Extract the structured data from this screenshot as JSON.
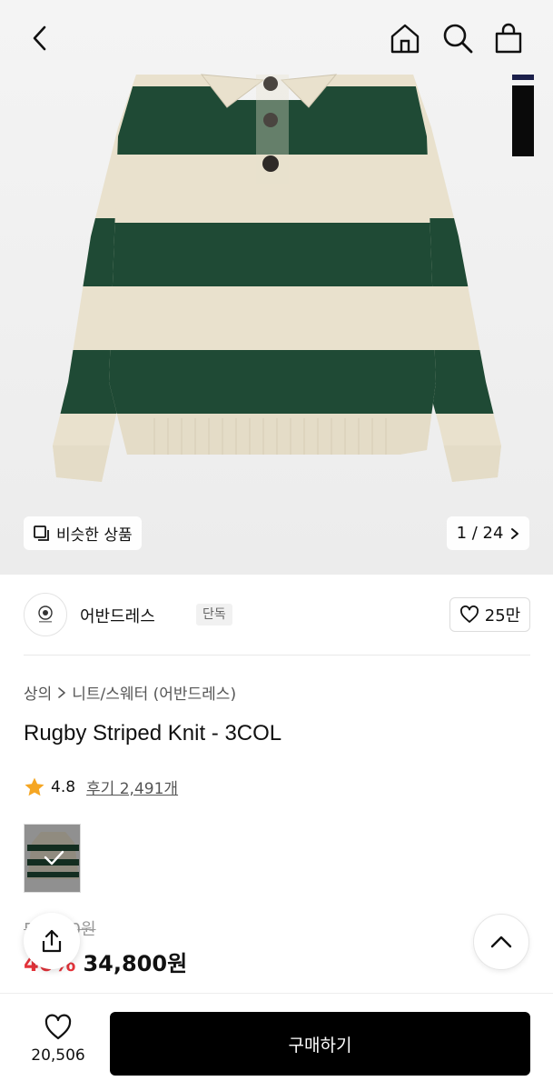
{
  "gallery": {
    "similar_label": "비슷한 상품",
    "counter": "1 / 24",
    "garment_colors": {
      "cream": "#e9e1cd",
      "green": "#1f4a35"
    }
  },
  "brand": {
    "name": "어반드레스",
    "tag": "단독",
    "likes": "25만"
  },
  "breadcrumb": {
    "category": "상의",
    "subcategory": "니트/스웨터 (어반드레스)"
  },
  "product": {
    "title": "Rugby Striped Knit - 3COL",
    "rating": "4.8",
    "review_link": "후기 2,491개"
  },
  "price": {
    "original": "58,000원",
    "discount": "40%",
    "final": "34,800원"
  },
  "bottom": {
    "wish_count": "20,506",
    "buy_label": "구매하기"
  },
  "colors": {
    "accent_red": "#e5333a",
    "star": "#f5a623",
    "button_bg": "#000000"
  }
}
